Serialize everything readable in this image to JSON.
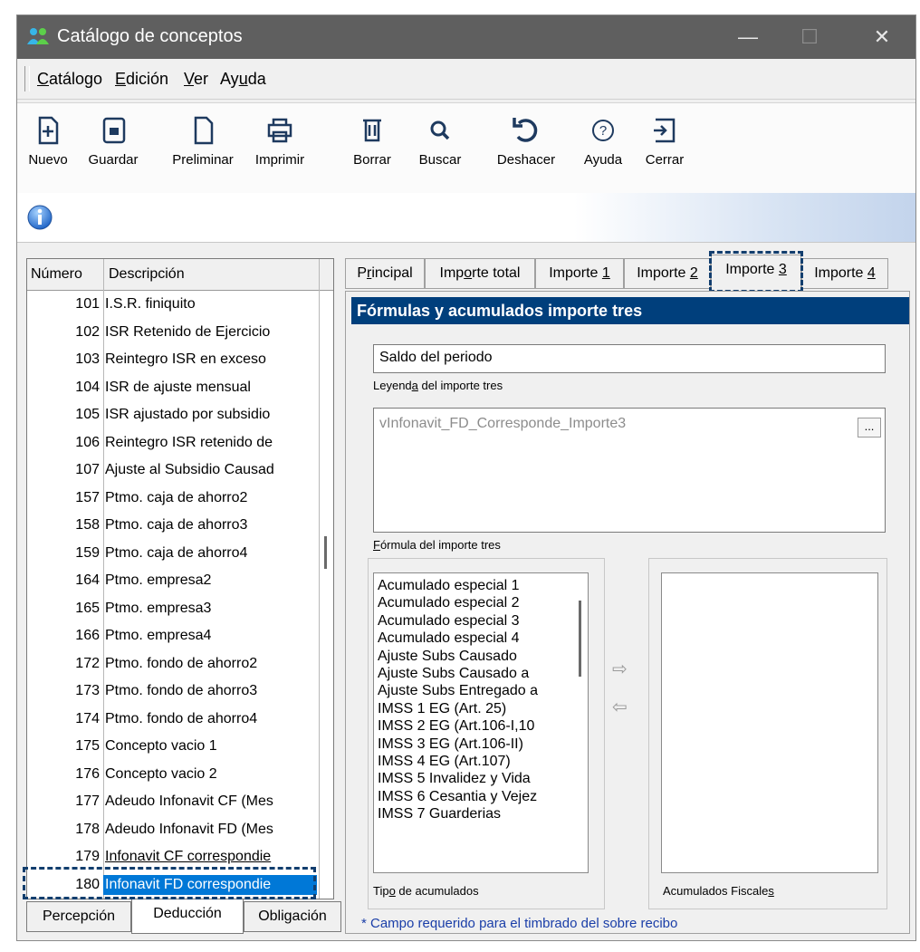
{
  "window": {
    "title": "Catálogo de conceptos",
    "minimize": "—",
    "maximize": "☐",
    "close": "✕"
  },
  "menu": [
    "Catálogo",
    "Edición",
    "Ver",
    "Ayuda"
  ],
  "toolbar": [
    {
      "label": "Nuevo",
      "icon": "new-doc-icon"
    },
    {
      "label": "Guardar",
      "icon": "save-icon"
    },
    {
      "label": "Preliminar",
      "icon": "preview-icon"
    },
    {
      "label": "Imprimir",
      "icon": "print-icon"
    },
    {
      "label": "Borrar",
      "icon": "trash-icon"
    },
    {
      "label": "Buscar",
      "icon": "search-icon"
    },
    {
      "label": "Deshacer",
      "icon": "undo-icon"
    },
    {
      "label": "Ayuda",
      "icon": "help-icon"
    },
    {
      "label": "Cerrar",
      "icon": "exit-icon"
    }
  ],
  "list": {
    "headers": [
      "Número",
      "Descripción"
    ],
    "rows": [
      {
        "num": "101",
        "desc": "I.S.R. finiquito"
      },
      {
        "num": "102",
        "desc": "ISR Retenido de Ejercicio"
      },
      {
        "num": "103",
        "desc": "Reintegro ISR en exceso"
      },
      {
        "num": "104",
        "desc": "ISR de ajuste mensual"
      },
      {
        "num": "105",
        "desc": "ISR ajustado por subsidio"
      },
      {
        "num": "106",
        "desc": "Reintegro ISR retenido de"
      },
      {
        "num": "107",
        "desc": "Ajuste al Subsidio Causad"
      },
      {
        "num": "157",
        "desc": "Ptmo. caja de ahorro2"
      },
      {
        "num": "158",
        "desc": "Ptmo. caja de ahorro3"
      },
      {
        "num": "159",
        "desc": "Ptmo. caja de ahorro4"
      },
      {
        "num": "164",
        "desc": "Ptmo. empresa2"
      },
      {
        "num": "165",
        "desc": "Ptmo. empresa3"
      },
      {
        "num": "166",
        "desc": "Ptmo. empresa4"
      },
      {
        "num": "172",
        "desc": "Ptmo. fondo de ahorro2"
      },
      {
        "num": "173",
        "desc": "Ptmo. fondo de ahorro3"
      },
      {
        "num": "174",
        "desc": "Ptmo. fondo de ahorro4"
      },
      {
        "num": "175",
        "desc": "Concepto vacio 1"
      },
      {
        "num": "176",
        "desc": "Concepto vacio 2"
      },
      {
        "num": "177",
        "desc": "Adeudo Infonavit CF (Mes"
      },
      {
        "num": "178",
        "desc": "Adeudo Infonavit FD (Mes"
      },
      {
        "num": "179",
        "desc": "Infonavit CF correspondie"
      },
      {
        "num": "180",
        "desc": "Infonavit FD correspondie",
        "selected": true
      }
    ]
  },
  "bottom_tabs": [
    "Percepción",
    "Deducción",
    "Obligación"
  ],
  "tabs": [
    "Principal",
    "Importe total",
    "Importe 1",
    "Importe 2",
    "Importe 3",
    "Importe 4"
  ],
  "active_tab": "Importe 3",
  "section_title": "Fórmulas y acumulados importe tres",
  "legend": {
    "value": "Saldo del periodo",
    "label": "Leyenda del importe tres"
  },
  "formula": {
    "value": "vInfonavit_FD_Corresponde_Importe3",
    "label": "Fórmula del importe tres",
    "button": "..."
  },
  "acumulados": [
    "Acumulado especial 1",
    "Acumulado especial 2",
    "Acumulado especial 3",
    "Acumulado especial 4",
    "Ajuste Subs Causado",
    "Ajuste Subs Causado a",
    "Ajuste Subs Entregado a",
    "IMSS 1 EG (Art. 25)",
    "IMSS 2 EG (Art.106-I,10",
    "IMSS 3 EG (Art.106-II)",
    "IMSS 4 EG (Art.107)",
    "IMSS 5 Invalidez y Vida",
    "IMSS 6 Cesantia y Vejez",
    "IMSS 7 Guarderias"
  ],
  "tipo_label": "Tipo de acumulados",
  "fiscales_label": "Acumulados Fiscales",
  "arrows": {
    "right": "⇨",
    "left": "⇦"
  },
  "footer_note": "* Campo requerido para el timbrado del sobre recibo",
  "colors": {
    "section": "#003f7c",
    "selection": "#0078d7",
    "highlight_dash": "#123e6e",
    "footer_text": "#1a3ea8",
    "titlebar": "#5f5f5f"
  }
}
